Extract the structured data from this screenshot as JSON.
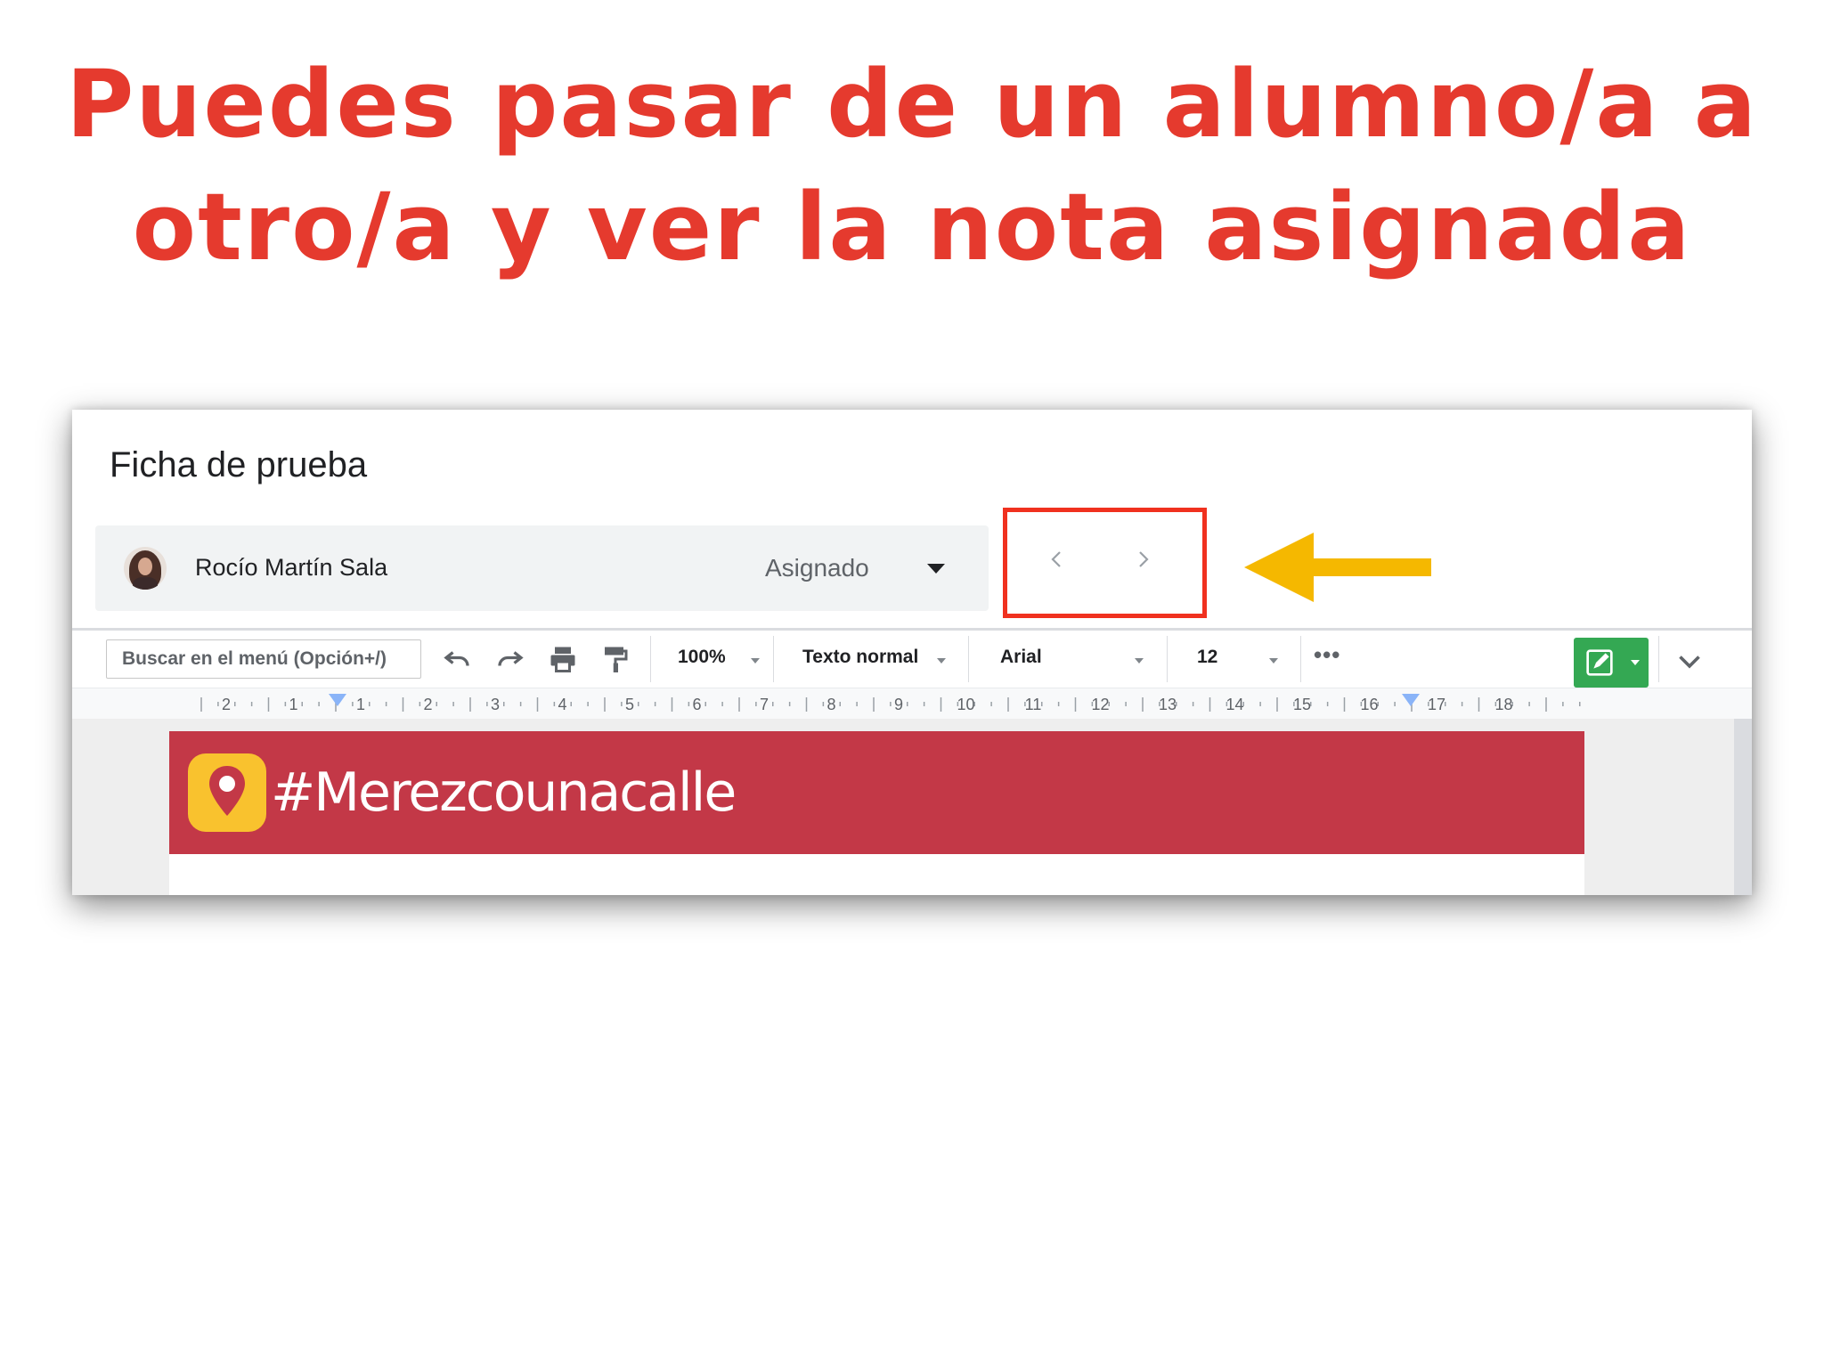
{
  "headline": {
    "line1": "Puedes pasar de un alumno/a a",
    "line2": "otro/a y ver la nota asignada"
  },
  "classroom": {
    "doc_title": "Ficha de prueba",
    "student": {
      "name": "Rocío Martín Sala",
      "status": "Asignado"
    },
    "nav": {
      "prev_icon": "chevron-left-icon",
      "next_icon": "chevron-right-icon"
    },
    "highlight_color": "#f0311f",
    "pointer_arrow_color": "#f5b800"
  },
  "toolbar": {
    "search_placeholder": "Buscar en el menú (Opción+/)",
    "zoom": "100%",
    "style": "Texto normal",
    "font": "Arial",
    "font_size": "12",
    "more": "•••",
    "edit_color": "#34a853"
  },
  "ruler": {
    "labels": [
      "2",
      "1",
      "1",
      "2",
      "3",
      "4",
      "5",
      "6",
      "7",
      "8",
      "9",
      "10",
      "11",
      "12",
      "13",
      "14",
      "15",
      "16",
      "17",
      "18"
    ]
  },
  "document": {
    "banner_text": "#Merezcounacalle",
    "banner_color": "#c33847",
    "icon_color": "#f9c22e"
  }
}
